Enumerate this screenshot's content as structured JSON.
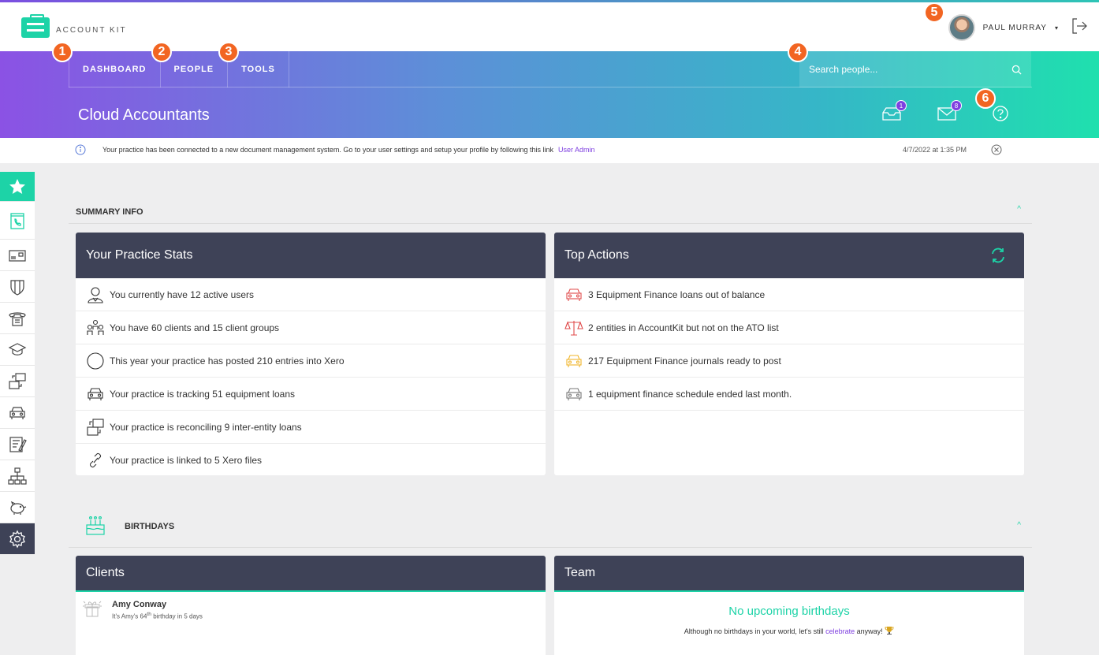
{
  "app": {
    "logo_text": "ACCOUNT KIT"
  },
  "user": {
    "name": "PAUL MURRAY",
    "caret": "▾"
  },
  "nav": {
    "items": [
      {
        "label": "DASHBOARD"
      },
      {
        "label": "PEOPLE"
      },
      {
        "label": "TOOLS"
      }
    ],
    "search_placeholder": "Search people..."
  },
  "header": {
    "title": "Cloud Accountants",
    "inbox_count": "1",
    "mail_count": "8"
  },
  "notice": {
    "message": "Your practice has been connected to a new document management system. Go to your user settings and setup your profile by following this link",
    "link": "User Admin",
    "timestamp": "4/7/2022 at 1:35 PM"
  },
  "summary": {
    "section_title": "SUMMARY INFO",
    "collapse": "^",
    "stats": {
      "title": "Your Practice Stats",
      "rows": [
        {
          "icon": "user-icon",
          "text": "You currently have 12 active users"
        },
        {
          "icon": "group-icon",
          "text": "You have 60 clients and 15 client groups"
        },
        {
          "icon": "circle-icon",
          "text": "This year your practice has posted 210 entries into Xero"
        },
        {
          "icon": "car-icon",
          "text": "Your practice is tracking 51 equipment loans"
        },
        {
          "icon": "transfer-icon",
          "text": "Your practice is reconciling 9 inter-entity loans"
        },
        {
          "icon": "link-icon",
          "text": "Your practice is linked to 5 Xero files"
        }
      ]
    },
    "actions": {
      "title": "Top Actions",
      "rows": [
        {
          "icon": "car-icon",
          "color": "#e04b4b",
          "text": "3  Equipment Finance loans out of balance"
        },
        {
          "icon": "scales-icon",
          "color": "#e04b4b",
          "text": "2 entities in AccountKit but not on the ATO list"
        },
        {
          "icon": "car-icon",
          "color": "#f0b52a",
          "text": "217  Equipment Finance journals ready to post"
        },
        {
          "icon": "car-icon",
          "color": "#777777",
          "text": "1  equipment finance schedule ended last month."
        }
      ]
    }
  },
  "birthdays": {
    "section_title": "BIRTHDAYS",
    "collapse": "^",
    "clients": {
      "title": "Clients",
      "entries": [
        {
          "name": "Amy Conway",
          "desc_pre": "It's Amy's 64",
          "sup": "th",
          "desc_post": " birthday in 5 days"
        }
      ]
    },
    "team": {
      "title": "Team",
      "empty_title": "No upcoming birthdays",
      "empty_pre": "Although no birthdays in your world, let's still ",
      "empty_link": "celebrate",
      "empty_post": " anyway!"
    }
  },
  "markers": [
    "1",
    "2",
    "3",
    "4",
    "5",
    "6"
  ],
  "colors": {
    "accent": "#1dd3a7",
    "purple": "#7e3fe0",
    "dark": "#3e4257",
    "marker": "#f26522"
  }
}
